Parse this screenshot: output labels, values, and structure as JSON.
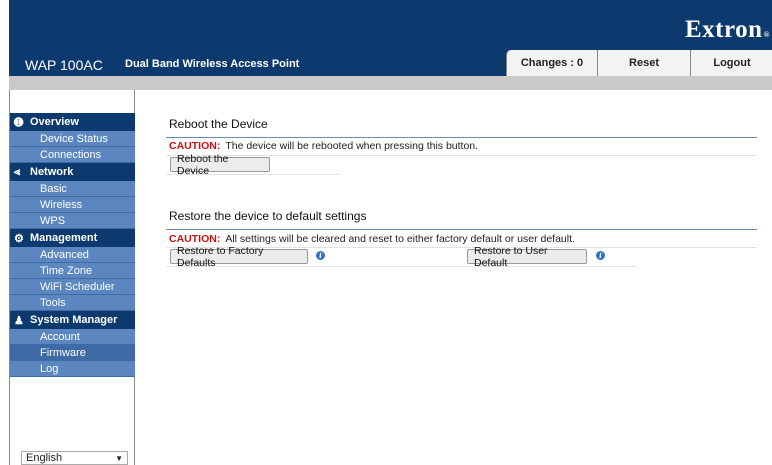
{
  "header": {
    "logo": "Extron",
    "logo_mark": "®",
    "model": "WAP 100AC",
    "subtitle": "Dual Band Wireless Access Point",
    "changes_label": "Changes : 0",
    "reset_label": "Reset",
    "logout_label": "Logout"
  },
  "sidebar": {
    "sections": [
      {
        "label": "Overview",
        "icon": "info-icon",
        "items": [
          "Device Status",
          "Connections"
        ]
      },
      {
        "label": "Network",
        "icon": "share-icon",
        "items": [
          "Basic",
          "Wireless",
          "WPS"
        ]
      },
      {
        "label": "Management",
        "icon": "gear-icon",
        "items": [
          "Advanced",
          "Time Zone",
          "WiFi Scheduler",
          "Tools"
        ]
      },
      {
        "label": "System Manager",
        "icon": "user-icon",
        "items": [
          "Account",
          "Firmware",
          "Log"
        ]
      }
    ],
    "language": "English",
    "active_item": "Firmware"
  },
  "reboot": {
    "title": "Reboot the Device",
    "caution_label": "CAUTION:",
    "caution_text": "The device will be rebooted when pressing this button.",
    "button": "Reboot the Device"
  },
  "restore": {
    "title": "Restore the device to default settings",
    "caution_label": "CAUTION:",
    "caution_text": "All settings will be cleared and reset to either factory default or user default.",
    "factory_button": "Restore to Factory Defaults",
    "user_button": "Restore to User Default"
  },
  "colors": {
    "header": "#0d3a6e",
    "nav_item": "#5b86c0",
    "caution": "#cc1111"
  }
}
